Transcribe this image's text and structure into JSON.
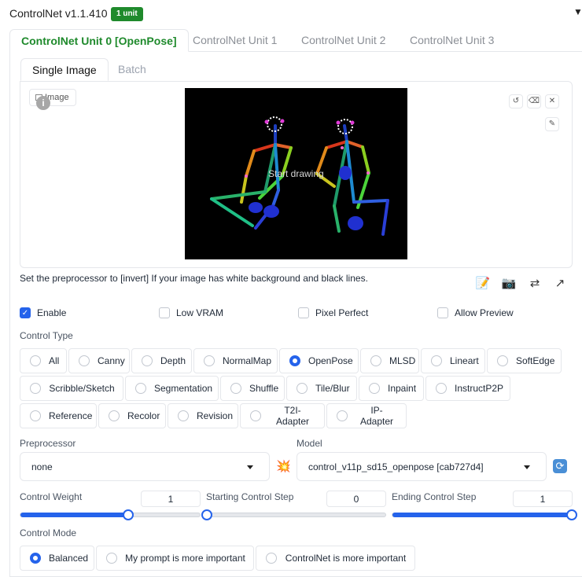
{
  "header": {
    "title": "ControlNet v1.1.410",
    "badge": "1 unit",
    "collapse_icon": "▼"
  },
  "unit_tabs": [
    {
      "label": "ControlNet Unit 0 [OpenPose]",
      "active": true
    },
    {
      "label": "ControlNet Unit 1",
      "active": false
    },
    {
      "label": "ControlNet Unit 2",
      "active": false
    },
    {
      "label": "ControlNet Unit 3",
      "active": false
    }
  ],
  "image_tabs": [
    {
      "label": "Single Image",
      "active": true
    },
    {
      "label": "Batch",
      "active": false
    }
  ],
  "image_panel": {
    "label": "Image",
    "info_icon": "i",
    "canvas_overlay": "Start drawing",
    "controls": {
      "undo": "↺",
      "erase": "⌫",
      "close": "✕",
      "brush": "✎"
    }
  },
  "hint": "Set the preprocessor to [invert] If your image has white background and black lines.",
  "tool_icons": [
    "📝",
    "📷",
    "⇄",
    "↗"
  ],
  "checkboxes": [
    {
      "label": "Enable",
      "checked": true
    },
    {
      "label": "Low VRAM",
      "checked": false
    },
    {
      "label": "Pixel Perfect",
      "checked": false
    },
    {
      "label": "Allow Preview",
      "checked": false
    }
  ],
  "control_type": {
    "label": "Control Type",
    "selected": "OpenPose",
    "options": [
      "All",
      "Canny",
      "Depth",
      "NormalMap",
      "OpenPose",
      "MLSD",
      "Lineart",
      "SoftEdge",
      "Scribble/Sketch",
      "Segmentation",
      "Shuffle",
      "Tile/Blur",
      "Inpaint",
      "InstructP2P",
      "Reference",
      "Recolor",
      "Revision",
      "T2I-Adapter",
      "IP-Adapter"
    ]
  },
  "preprocessor": {
    "label": "Preprocessor",
    "value": "none",
    "run_icon": "💥"
  },
  "model": {
    "label": "Model",
    "value": "control_v11p_sd15_openpose [cab727d4]",
    "refresh_icon": "⟳"
  },
  "sliders": [
    {
      "label": "Control Weight",
      "value": "1",
      "fraction": 0.6
    },
    {
      "label": "Starting Control Step",
      "value": "0",
      "fraction": 0.0
    },
    {
      "label": "Ending Control Step",
      "value": "1",
      "fraction": 1.0
    }
  ],
  "control_mode": {
    "label": "Control Mode",
    "selected": "Balanced",
    "options": [
      "Balanced",
      "My prompt is more important",
      "ControlNet is more important"
    ]
  },
  "colors": {
    "accent_green": "#1f8a2c",
    "accent_blue": "#2563eb"
  }
}
